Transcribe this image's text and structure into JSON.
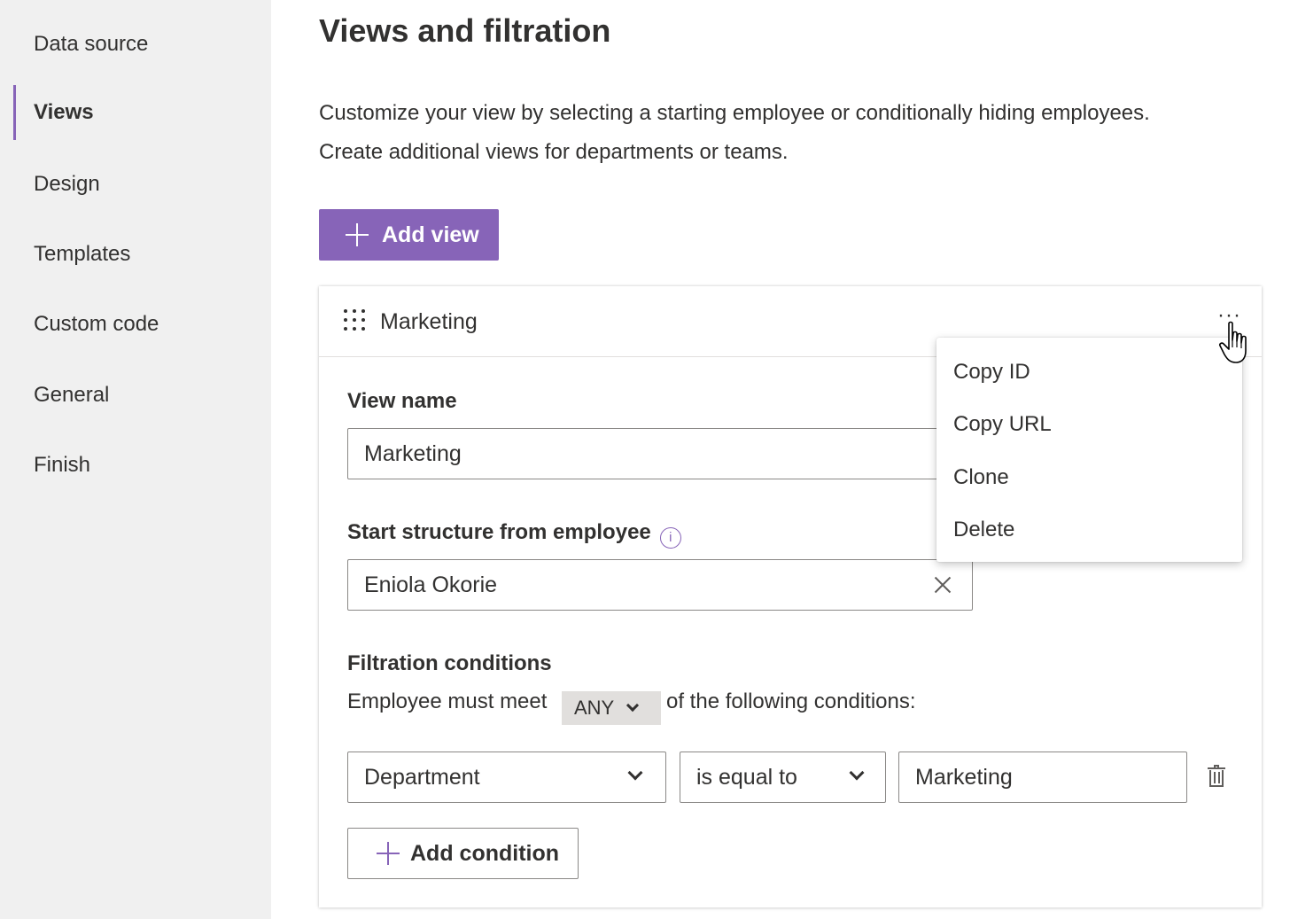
{
  "sidebar": {
    "items": [
      {
        "label": "Data source"
      },
      {
        "label": "Views"
      },
      {
        "label": "Design"
      },
      {
        "label": "Templates"
      },
      {
        "label": "Custom code"
      },
      {
        "label": "General"
      },
      {
        "label": "Finish"
      }
    ],
    "active": "Views"
  },
  "main": {
    "title": "Views and filtration",
    "description_line1": "Customize your view by selecting a starting employee or conditionally hiding employees.",
    "description_line2": "Create additional views for departments or teams.",
    "add_view_label": "Add view"
  },
  "view_card": {
    "title": "Marketing",
    "view_name_label": "View name",
    "view_name_value": "Marketing",
    "start_label": "Start structure from employee",
    "start_value": "Eniola Okorie",
    "filtration_label": "Filtration conditions",
    "cond_prefix": "Employee must meet",
    "cond_match": "ANY",
    "cond_suffix": "of the following conditions:",
    "condition": {
      "field": "Department",
      "operator": "is equal to",
      "value": "Marketing"
    },
    "add_condition_label": "Add condition"
  },
  "context_menu": {
    "items": [
      "Copy ID",
      "Copy URL",
      "Clone",
      "Delete"
    ]
  },
  "colors": {
    "accent": "#8764b8",
    "sidebar_bg": "#f0f0f0"
  }
}
